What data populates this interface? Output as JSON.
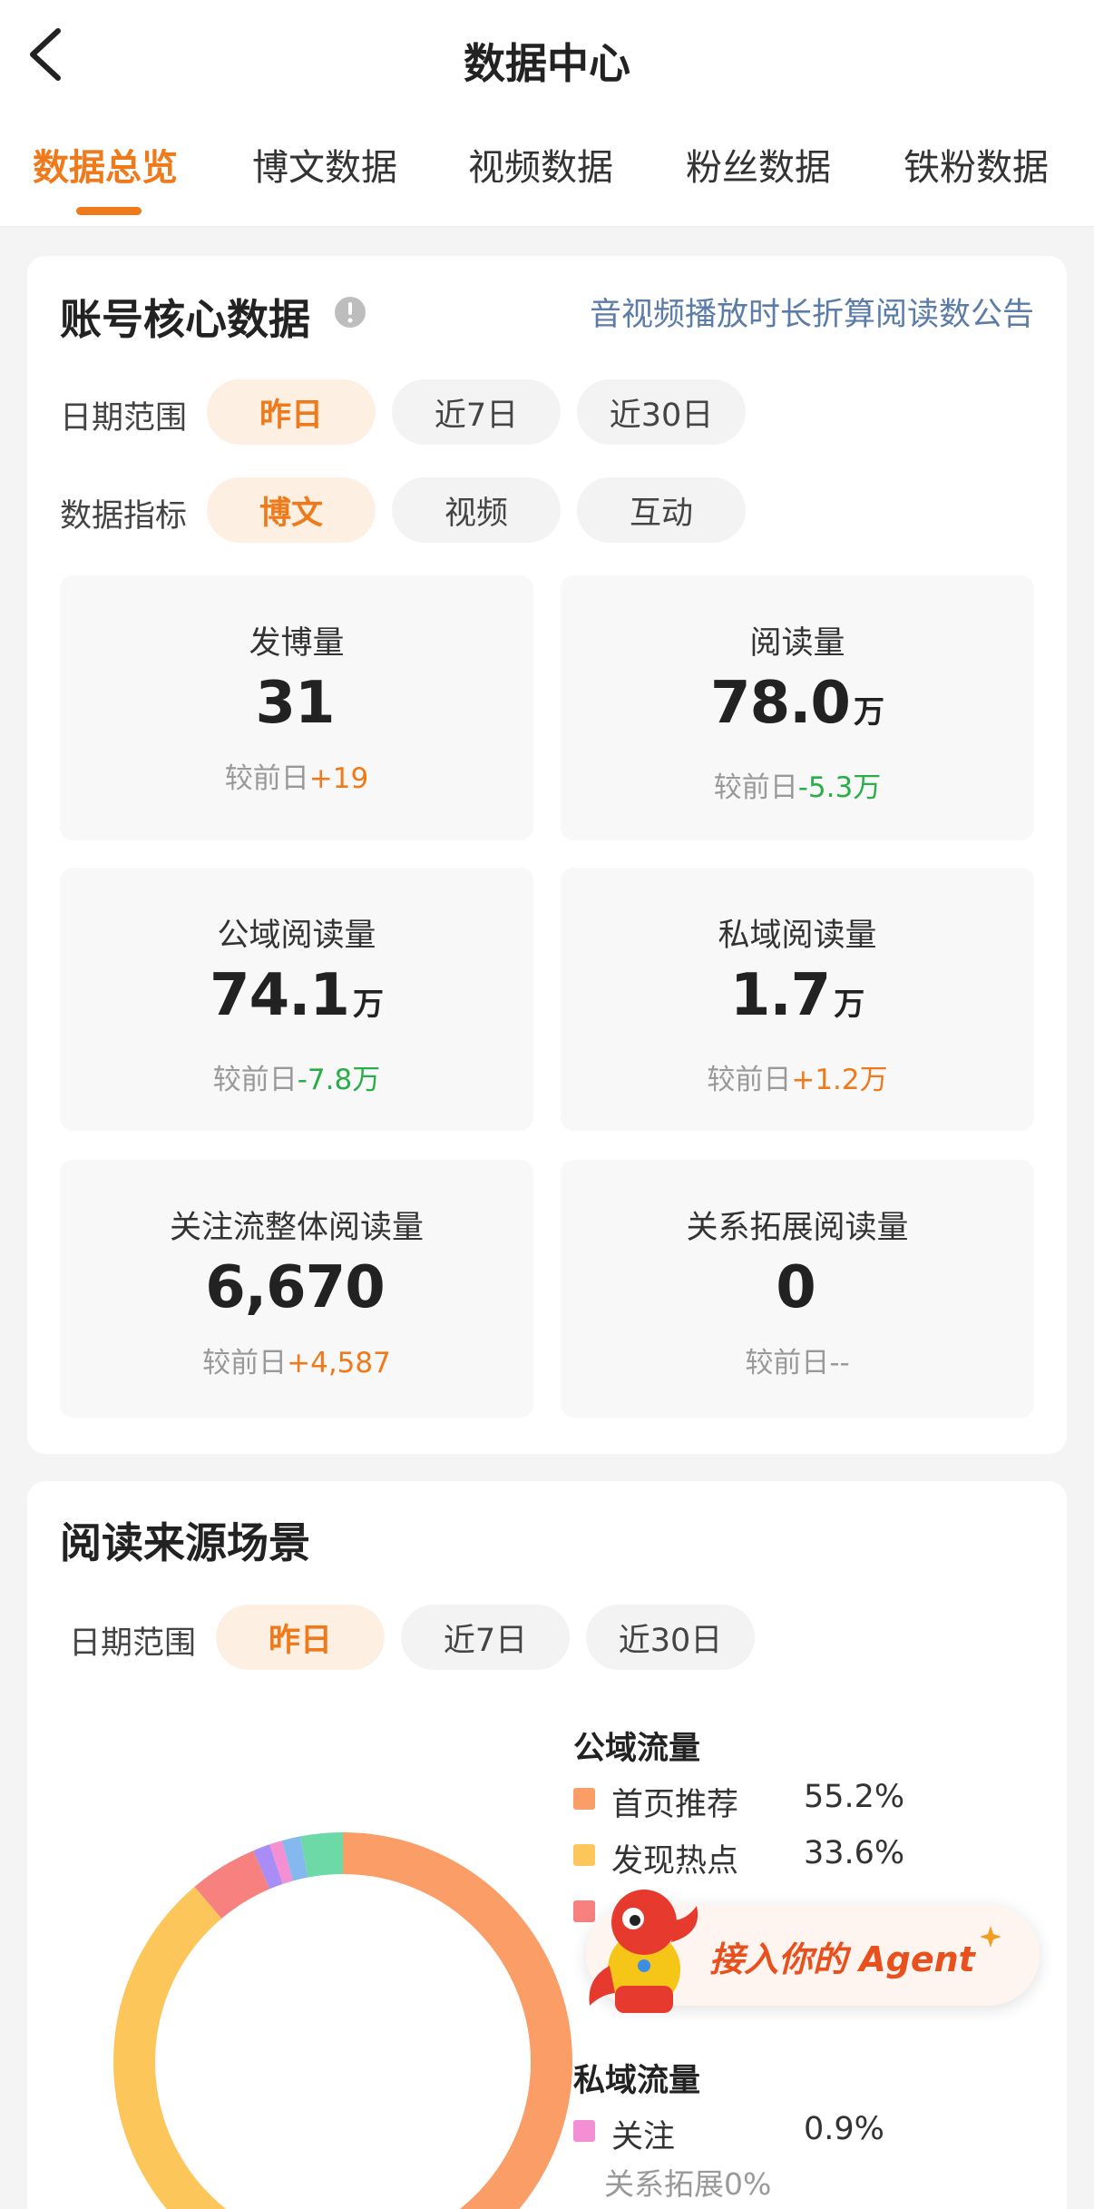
{
  "header": {
    "title": "数据中心",
    "tabs": [
      {
        "label": "数据总览",
        "active": true
      },
      {
        "label": "博文数据",
        "active": false
      },
      {
        "label": "视频数据",
        "active": false
      },
      {
        "label": "粉丝数据",
        "active": false
      },
      {
        "label": "铁粉数据",
        "active": false
      }
    ]
  },
  "core": {
    "title": "账号核心数据",
    "notice_link": "音视频播放时长折算阅读数公告",
    "date_range_label": "日期范围",
    "date_options": [
      "昨日",
      "近7日",
      "近30日"
    ],
    "selected_date": "昨日",
    "metric_label": "数据指标",
    "metric_options": [
      "博文",
      "视频",
      "互动"
    ],
    "selected_metric": "博文",
    "cards": [
      {
        "label": "发博量",
        "value": "31",
        "unit": "",
        "delta_prefix": "较前日",
        "delta": "+19",
        "trend": "up"
      },
      {
        "label": "阅读量",
        "value": "78.0",
        "unit": "万",
        "delta_prefix": "较前日",
        "delta": "-5.3万",
        "trend": "down"
      },
      {
        "label": "公域阅读量",
        "value": "74.1",
        "unit": "万",
        "delta_prefix": "较前日",
        "delta": "-7.8万",
        "trend": "down"
      },
      {
        "label": "私域阅读量",
        "value": "1.7",
        "unit": "万",
        "delta_prefix": "较前日",
        "delta": "+1.2万",
        "trend": "up"
      },
      {
        "label": "关注流整体阅读量",
        "value": "6,670",
        "unit": "",
        "delta_prefix": "较前日",
        "delta": "+4,587",
        "trend": "up"
      },
      {
        "label": "关系拓展阅读量",
        "value": "0",
        "unit": "",
        "delta_prefix": "较前日",
        "delta": "--",
        "trend": "none"
      }
    ]
  },
  "source": {
    "title": "阅读来源场景",
    "date_range_label": "日期范围",
    "date_options": [
      "昨日",
      "近7日",
      "近30日"
    ],
    "selected_date": "昨日",
    "public_title": "公域流量",
    "public_items": [
      {
        "name": "首页推荐",
        "pct": "55.2%",
        "color": "#fa9d66"
      },
      {
        "name": "发现热点",
        "pct": "33.6%",
        "color": "#fdc65b"
      },
      {
        "name": "",
        "pct": "",
        "color": "#f7817f"
      }
    ],
    "private_title": "私域流量",
    "private_items": [
      {
        "name": "关注",
        "pct": "0.9%",
        "color": "#f48fd4"
      }
    ],
    "private_sub": "关系拓展0%"
  },
  "chart_data": {
    "type": "pie",
    "segments": [
      {
        "name": "首页推荐",
        "value": 55.2,
        "color": "#fa9d66"
      },
      {
        "name": "发现热点",
        "value": 33.6,
        "color": "#fdc65b"
      },
      {
        "name": "",
        "value": 4.8,
        "color": "#f7817f"
      },
      {
        "name": "",
        "value": 1.2,
        "color": "#a98cf5"
      },
      {
        "name": "关注",
        "value": 0.9,
        "color": "#f48fd4"
      },
      {
        "name": "",
        "value": 1.3,
        "color": "#86b8f0"
      },
      {
        "name": "",
        "value": 3.0,
        "color": "#6dd9a7"
      }
    ]
  },
  "agent_banner": {
    "text": "接入你的 Agent"
  },
  "colors": {
    "accent": "#ee7a1b",
    "up": "#ee7a1b",
    "down": "#2aae4a",
    "link": "#5b7ca8"
  }
}
